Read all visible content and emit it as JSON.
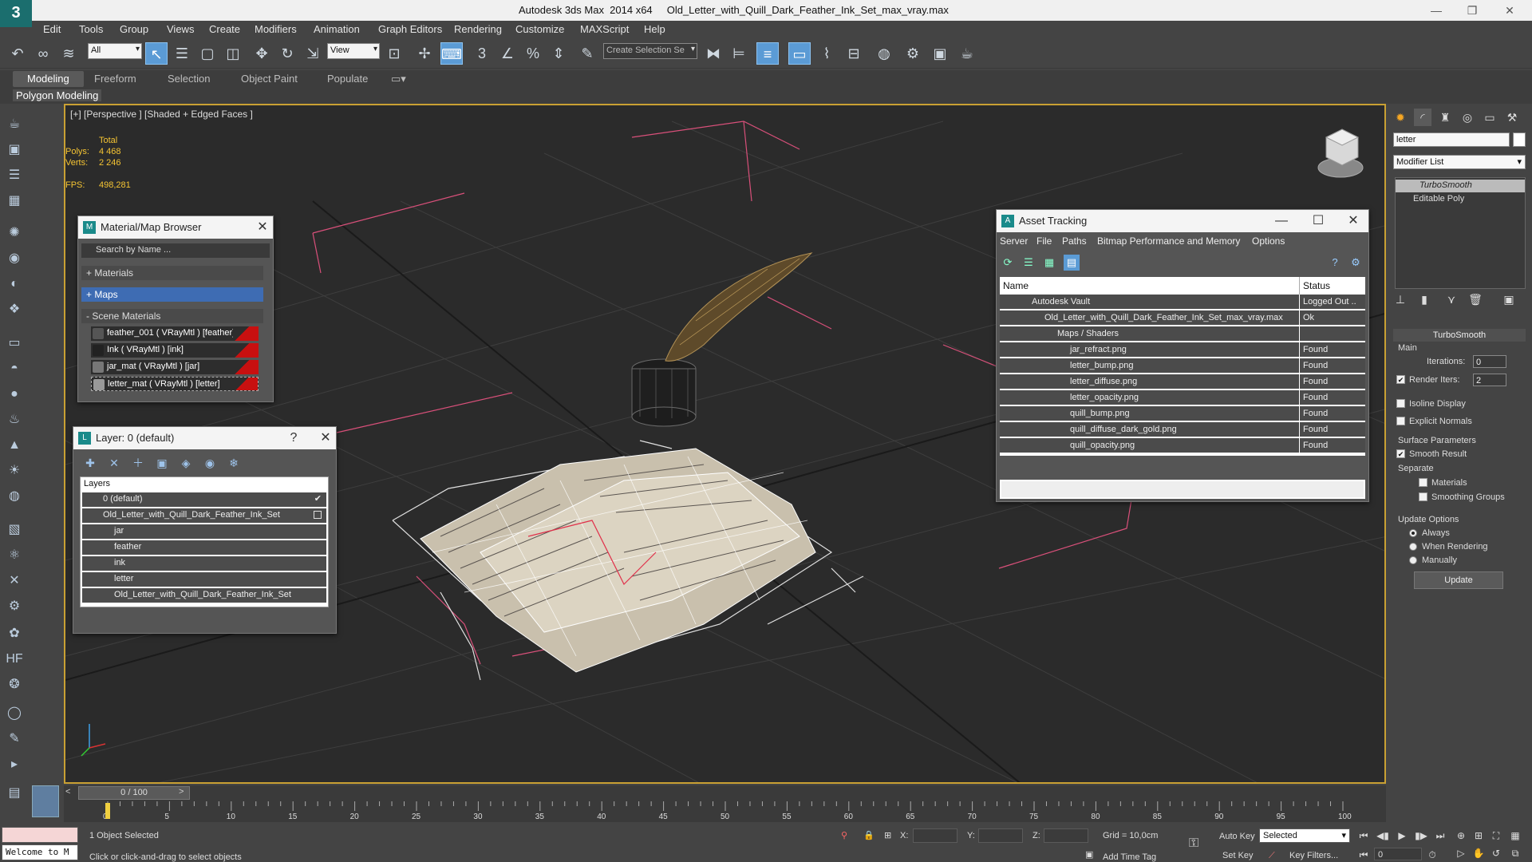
{
  "app": {
    "logo_glyph": "3",
    "title": "Autodesk 3ds Max  2014 x64     Old_Letter_with_Quill_Dark_Feather_Ink_Set_max_vray.max",
    "minimize": "—",
    "restore": "❐",
    "close": "✕"
  },
  "menu": [
    "Edit",
    "Tools",
    "Group",
    "Views",
    "Create",
    "Modifiers",
    "Animation",
    "Graph Editors",
    "Rendering",
    "Customize",
    "MAXScript",
    "Help"
  ],
  "toolbar": {
    "filter_value": "All",
    "refcoord_value": "View",
    "selection_set_placeholder": "Create Selection Se"
  },
  "ribbon": {
    "tabs": [
      "Modeling",
      "Freeform",
      "Selection",
      "Object Paint",
      "Populate"
    ],
    "active_tab": "Modeling",
    "sub_label": "Polygon Modeling"
  },
  "viewport": {
    "label": "[+] [Perspective ] [Shaded + Edged Faces ]",
    "stats_header": "Total",
    "polys_label": "Polys:",
    "polys_value": "4 468",
    "verts_label": "Verts:",
    "verts_value": "2 246",
    "fps_label": "FPS:",
    "fps_value": "498,281"
  },
  "material_browser": {
    "title": "Material/Map Browser",
    "search_placeholder": "Search by Name ...",
    "groups": [
      "+ Materials",
      "+ Maps",
      "- Scene Materials"
    ],
    "items": [
      "feather_001  ( VRayMtl ) [feather]",
      "Ink  ( VRayMtl ) [ink]",
      "jar_mat  ( VRayMtl ) [jar]",
      "letter_mat  ( VRayMtl ) [letter]"
    ]
  },
  "layer_panel": {
    "title": "Layer: 0 (default)",
    "help": "?",
    "header": "Layers",
    "rows": [
      {
        "label": "0 (default)",
        "indent": 1
      },
      {
        "label": "Old_Letter_with_Quill_Dark_Feather_Ink_Set",
        "indent": 1
      },
      {
        "label": "jar",
        "indent": 2
      },
      {
        "label": "feather",
        "indent": 2
      },
      {
        "label": "ink",
        "indent": 2
      },
      {
        "label": "letter",
        "indent": 2
      },
      {
        "label": "Old_Letter_with_Quill_Dark_Feather_Ink_Set",
        "indent": 2
      }
    ]
  },
  "asset_tracking": {
    "title": "Asset Tracking",
    "menu": [
      "Server",
      "File",
      "Paths",
      "Bitmap Performance and Memory",
      "Options"
    ],
    "col_name": "Name",
    "col_status": "Status",
    "rows": [
      {
        "name": "Autodesk Vault",
        "status": "Logged Out ..",
        "level": 1
      },
      {
        "name": "Old_Letter_with_Quill_Dark_Feather_Ink_Set_max_vray.max",
        "status": "Ok",
        "level": 2
      },
      {
        "name": "Maps / Shaders",
        "status": "",
        "level": 3
      },
      {
        "name": "jar_refract.png",
        "status": "Found",
        "level": 4
      },
      {
        "name": "letter_bump.png",
        "status": "Found",
        "level": 4
      },
      {
        "name": "letter_diffuse.png",
        "status": "Found",
        "level": 4
      },
      {
        "name": "letter_opacity.png",
        "status": "Found",
        "level": 4
      },
      {
        "name": "quill_bump.png",
        "status": "Found",
        "level": 4
      },
      {
        "name": "quill_diffuse_dark_gold.png",
        "status": "Found",
        "level": 4
      },
      {
        "name": "quill_opacity.png",
        "status": "Found",
        "level": 4
      }
    ]
  },
  "command_panel": {
    "name_value": "letter",
    "modifier_list": "Modifier List",
    "stack": [
      "TurboSmooth",
      "Editable Poly"
    ],
    "rollout_title": "TurboSmooth",
    "main_label": "Main",
    "iterations_label": "Iterations:",
    "iterations_value": "0",
    "render_iters_label": "Render Iters:",
    "render_iters_value": "2",
    "isoline_label": "Isoline Display",
    "explicit_label": "Explicit Normals",
    "surface_label": "Surface Parameters",
    "smooth_label": "Smooth Result",
    "separate_label": "Separate",
    "materials_label": "Materials",
    "smoothing_groups_label": "Smoothing Groups",
    "update_options_label": "Update Options",
    "always_label": "Always",
    "when_rendering_label": "When Rendering",
    "manually_label": "Manually",
    "update_button": "Update"
  },
  "timeline": {
    "slider": "0 / 100",
    "ticks": [
      "0",
      "5",
      "10",
      "15",
      "20",
      "25",
      "30",
      "35",
      "40",
      "45",
      "50",
      "55",
      "60",
      "65",
      "70",
      "75",
      "80",
      "85",
      "90",
      "95",
      "100"
    ]
  },
  "status": {
    "listener": "Welcome to M",
    "selected": "1 Object Selected",
    "prompt": "Click or click-and-drag to select objects",
    "x_label": "X:",
    "y_label": "Y:",
    "z_label": "Z:",
    "grid": "Grid = 10,0cm",
    "add_time_tag": "Add Time Tag",
    "auto_key": "Auto Key",
    "set_key": "Set Key",
    "selected_value": "Selected",
    "key_filters": "Key Filters...",
    "frame_value": "0"
  },
  "colors": {
    "accent": "#5b9bd5",
    "viewport_border": "#c9a033",
    "stat_yellow": "#f5c433",
    "selection_red": "#c81010"
  }
}
